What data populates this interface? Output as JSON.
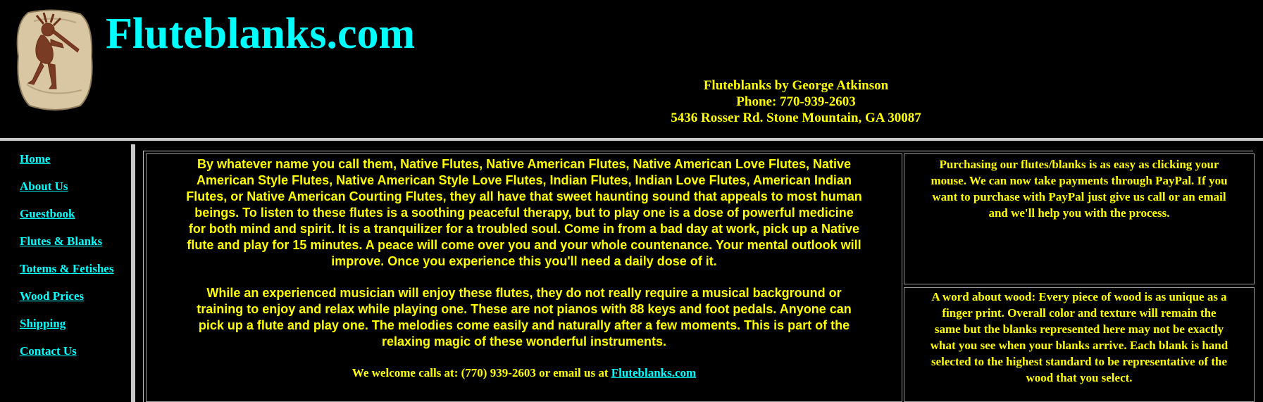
{
  "header": {
    "site_title": "Fluteblanks.com",
    "logo_icon": "kokopelli-flute-player-stone-icon",
    "contact_lines": [
      "Fluteblanks by George Atkinson",
      "Phone: 770-939-2603",
      "5436 Rosser Rd. Stone Mountain, GA 30087"
    ]
  },
  "nav": {
    "items": [
      "Home",
      "About Us",
      "Guestbook",
      "Flutes & Blanks",
      "Totems & Fetishes",
      "Wood Prices",
      "Shipping",
      "Contact Us"
    ]
  },
  "main": {
    "paragraph1_lines": [
      "By whatever name you call them, Native Flutes, Native American Flutes, Native American Love Flutes, Native",
      "American Style Flutes, Native American Style Love Flutes, Indian Flutes, Indian Love Flutes, American Indian",
      "Flutes, or Native American Courting Flutes, they all have that sweet haunting sound that appeals to most human",
      "beings. To listen to these flutes is a soothing peaceful therapy, but to play one is a dose of powerful medicine",
      "for both mind and spirit. It is a tranquilizer for a troubled soul. Come in from a bad day at work, pick up a Native",
      "flute and play for 15 minutes. A peace will come over you and your whole countenance. Your mental outlook will",
      "improve. Once you experience this you'll need a daily dose of it."
    ],
    "paragraph2_lines": [
      "While an experienced musician will enjoy these flutes, they do not really require a musical background or",
      "training to enjoy and relax while playing one. These are not pianos with 88 keys and foot pedals. Anyone can",
      "pick up a flute and play one. The melodies come easily and naturally after a few moments. This is part of the",
      "relaxing magic of these wonderful instruments."
    ],
    "welcome_text": "We welcome calls at: (770) 939-2603 or email us at ",
    "welcome_link": "Fluteblanks.com"
  },
  "side": {
    "purchase_lines": [
      "Purchasing our flutes/blanks is as easy as clicking your",
      "mouse. We can now take payments through PayPal. If you",
      "want to purchase with PayPal just give us call or an email",
      "and we'll help you with the process."
    ],
    "wood_lines": [
      "A word about wood: Every piece of wood is as unique as a",
      "finger print. Overall color and texture will remain the",
      "same but the blanks represented here may not be exactly",
      "what you see when your blanks arrive. Each blank is hand",
      "selected to the highest standard to be representative of the",
      "wood that you select."
    ]
  },
  "colors": {
    "background": "#000000",
    "title": "#00FFFF",
    "text": "#FFFF00",
    "link": "#00FFFF",
    "rule": "#C8C8C8"
  }
}
